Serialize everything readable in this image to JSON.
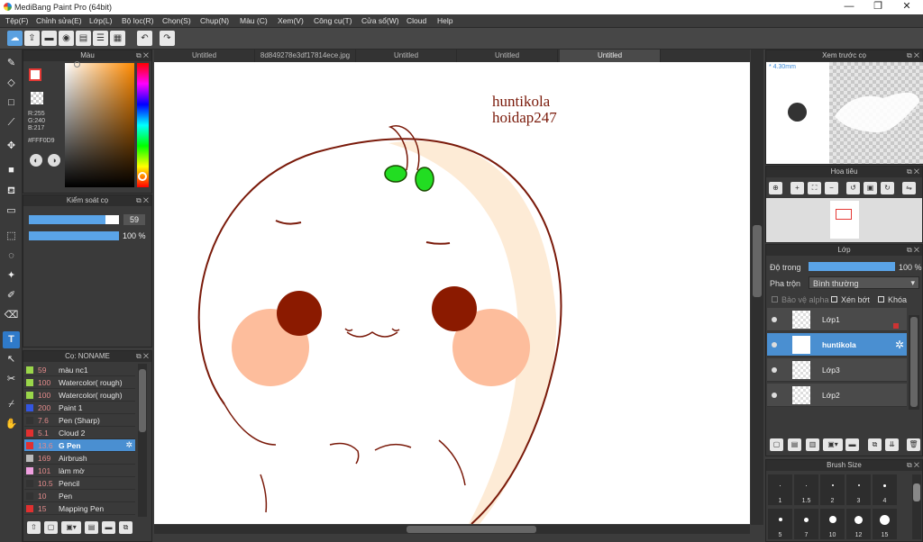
{
  "app": {
    "title": "MediBang Paint Pro (64bit)"
  },
  "window": {
    "minimize": "—",
    "maximize": "❐",
    "close": "✕"
  },
  "menu": [
    "Tệp(F)",
    "Chỉnh sửa(E)",
    "Lớp(L)",
    "Bộ lọc(R)",
    "Chọn(S)",
    "Chụp(N)",
    "Màu (C)",
    "Xem(V)",
    "Công cụ(T)",
    "Cửa sổ(W)",
    "Cloud",
    "Help"
  ],
  "tabs": [
    "Untitled",
    "8d849278e3df17814ece.jpg",
    "Untitled",
    "Untitled",
    "Untitled"
  ],
  "color_panel": {
    "title": "Màu",
    "r": "R:255",
    "g": "G:240",
    "b": "B:217",
    "hex": "#FFF0D9"
  },
  "brush_control": {
    "title": "Kiểm soát cọ",
    "size": "59",
    "opacity": "100 %",
    "size_fill": 0.85,
    "opacity_fill": 1.0
  },
  "brush_list": {
    "title": "Cọ: NONAME",
    "items": [
      {
        "size": "59",
        "name": "màu nc1",
        "color": "#9ad64a"
      },
      {
        "size": "100",
        "name": "Watercolor( rough)",
        "color": "#9ad64a"
      },
      {
        "size": "100",
        "name": "Watercolor( rough)",
        "color": "#9ad64a"
      },
      {
        "size": "200",
        "name": "Paint 1",
        "color": "#3355e0"
      },
      {
        "size": "7.6",
        "name": "Pen (Sharp)",
        "color": "#333333"
      },
      {
        "size": "5.1",
        "name": "Cloud 2",
        "color": "#e03030"
      },
      {
        "size": "13.6",
        "name": "G Pen",
        "color": "#e03030"
      },
      {
        "size": "169",
        "name": "Airbrush",
        "color": "#bbbbbb"
      },
      {
        "size": "101",
        "name": "làm mờ",
        "color": "#f0a0e0"
      },
      {
        "size": "10.5",
        "name": "Pencil",
        "color": "#333333"
      },
      {
        "size": "10",
        "name": "Pen",
        "color": "#333333"
      },
      {
        "size": "15",
        "name": "Mapping Pen",
        "color": "#e03030"
      }
    ],
    "selected_index": 6
  },
  "canvas": {
    "text_line1": "huntikola",
    "text_line2": "hoidap247"
  },
  "preview": {
    "title": "Xem trước cọ",
    "size_label": "4.30mm"
  },
  "navigator": {
    "title": "Hoa tiêu"
  },
  "layers_panel": {
    "title": "Lớp",
    "opacity_label": "Độ trong",
    "opacity_value": "100 %",
    "opacity_fill": 1.0,
    "blend_label": "Pha trộn",
    "blend_value": "Bình thường",
    "protect_alpha": "Bảo vệ alpha",
    "clipping": "Xén bớt",
    "lock": "Khóa",
    "layers": [
      {
        "name": "Lớp1",
        "selected": false
      },
      {
        "name": "huntikola",
        "selected": true
      },
      {
        "name": "Lớp3",
        "selected": false
      },
      {
        "name": "Lớp2",
        "selected": false
      }
    ]
  },
  "brush_size_panel": {
    "title": "Brush Size",
    "row1": [
      "1",
      "1.5",
      "2",
      "3",
      "4"
    ],
    "row2": [
      "5",
      "7",
      "10",
      "12",
      "15"
    ]
  }
}
